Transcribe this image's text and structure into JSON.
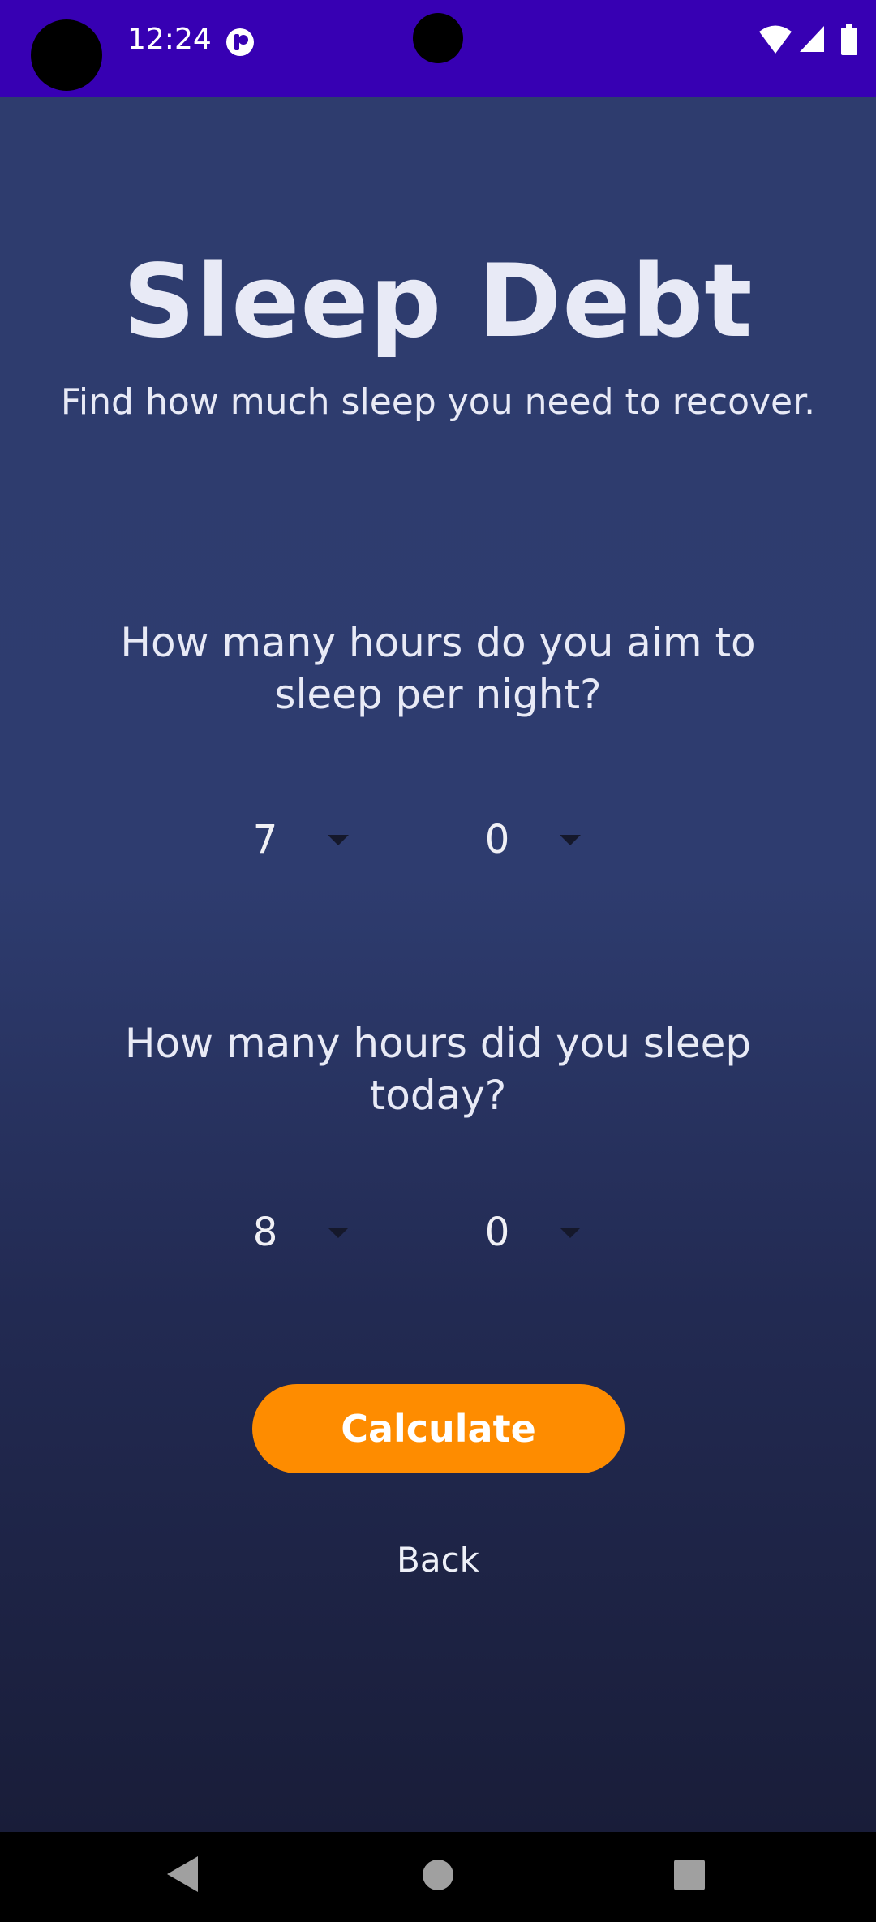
{
  "status_bar": {
    "time": "12:24",
    "color": "#3700b3",
    "icons": [
      "app-notification-icon",
      "wifi-icon",
      "cell-signal-icon",
      "battery-icon"
    ]
  },
  "page": {
    "title": "Sleep Debt",
    "subtitle": "Find how much sleep you need to recover."
  },
  "goal": {
    "question": "How many hours do you aim to sleep per night?",
    "hours_value": "7",
    "minutes_value": "0"
  },
  "actual": {
    "question": "How many hours did you sleep today?",
    "hours_value": "8",
    "minutes_value": "0"
  },
  "actions": {
    "calculate_label": "Calculate",
    "back_label": "Back"
  },
  "colors": {
    "accent": "#fe8c00",
    "background_top": "#2e3c6e",
    "background_bottom": "#191d39",
    "text": "#e8eaf6"
  },
  "nav_bar": {
    "icons": [
      "back-icon",
      "home-icon",
      "recents-icon"
    ]
  }
}
